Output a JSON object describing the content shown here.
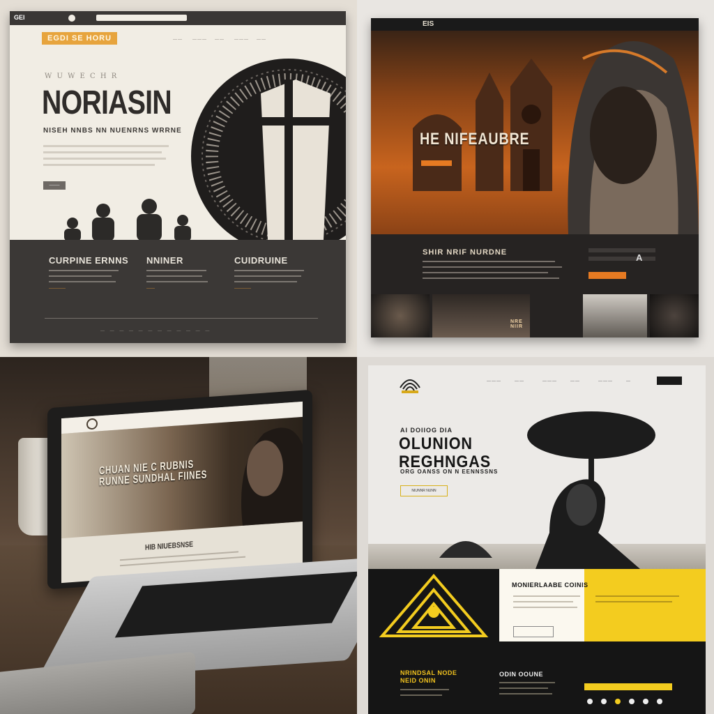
{
  "panel1": {
    "browser_label": "GEI",
    "brand": "EGDI SE HORU",
    "nav": [
      "——",
      "———",
      "——",
      "———",
      "——"
    ],
    "kicker": "W U W E C H R",
    "title": "NORIASIN",
    "subtitle": "NISEH NNBS NN NUENRNS WRRNE",
    "button": "———",
    "columns": [
      {
        "title": "CURPINE ERNNS",
        "more": "————"
      },
      {
        "title": "NNINER",
        "more": "——"
      },
      {
        "title": "CUIDRUINE",
        "more": "————"
      }
    ],
    "footer": "— — — — — — — — — — — —"
  },
  "panel2": {
    "logo": "EIS",
    "hero_title": "HE NIFEAUBRE",
    "band_title": "SHIR NRIF NURDNE",
    "form_mark": "A",
    "tag": "NRE NIIR",
    "colors": {
      "accent": "#e67a22",
      "dark": "#262322"
    }
  },
  "panel3": {
    "hero_title": "CHUAN NIE C RUBNIS RUNNE SUNDHAL FIINES",
    "section_title": "HIB NIUEBSNSE"
  },
  "panel4": {
    "kicker": "AI DOIIOG DIA",
    "title_line1": "OLUNION",
    "title_line2": "REGHNGAS",
    "subtitle": "ORG OANSS ON N EENNSSNS",
    "hero_button": "NIUNNR NUNN",
    "card_title": "MONIERLAABE COINIS",
    "footer_left": "NRINDSAL NODE NEID ONIN",
    "footer_mid": "ODIN OOUNE",
    "colors": {
      "accent": "#f3cc1f",
      "dark": "#151515"
    }
  }
}
